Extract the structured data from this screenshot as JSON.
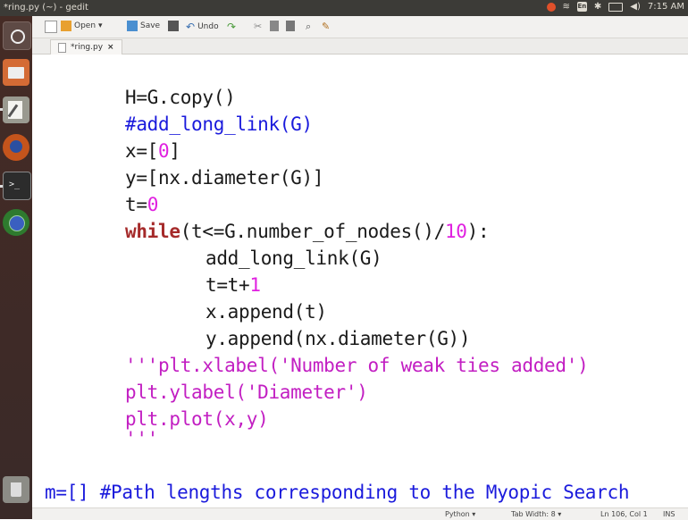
{
  "panel": {
    "title": "*ring.py (~) - gedit",
    "keyboard": "En",
    "clock": "7:15 AM"
  },
  "toolbar": {
    "open_label": "Open",
    "save_label": "Save",
    "undo_label": "Undo"
  },
  "tab": {
    "label": "*ring.py",
    "close": "×"
  },
  "code": {
    "l0": "'''",
    "l1": "H=G.copy()",
    "l2": "#add_long_link(G)",
    "l3a": "x=[",
    "l3b": "0",
    "l3c": "]",
    "l4": "y=[nx.diameter(G)]",
    "l5a": "t=",
    "l5b": "0",
    "l6a": "while",
    "l6b": "(t<=G.number_of_nodes()/",
    "l6c": "10",
    "l6d": "):",
    "l7": "add_long_link(G)",
    "l8a": "t=t+",
    "l8b": "1",
    "l9": "x.append(t)",
    "l10": "y.append(nx.diameter(G))",
    "l11": "'''plt.xlabel('Number of weak ties added')",
    "l12": "plt.ylabel('Diameter')",
    "l13": "plt.plot(x,y)",
    "l14": "'''",
    "l15": "m=[] #Path lengths corresponding to the Myopic Search"
  },
  "status": {
    "language": "Python ▾",
    "tab_width": "Tab Width: 8 ▾",
    "position": "Ln 106, Col 1",
    "mode": "INS"
  },
  "colors": {
    "keyword": "#a52a2a",
    "number": "#e020e0",
    "comment": "#1a1adc",
    "string": "#c21ec2"
  }
}
